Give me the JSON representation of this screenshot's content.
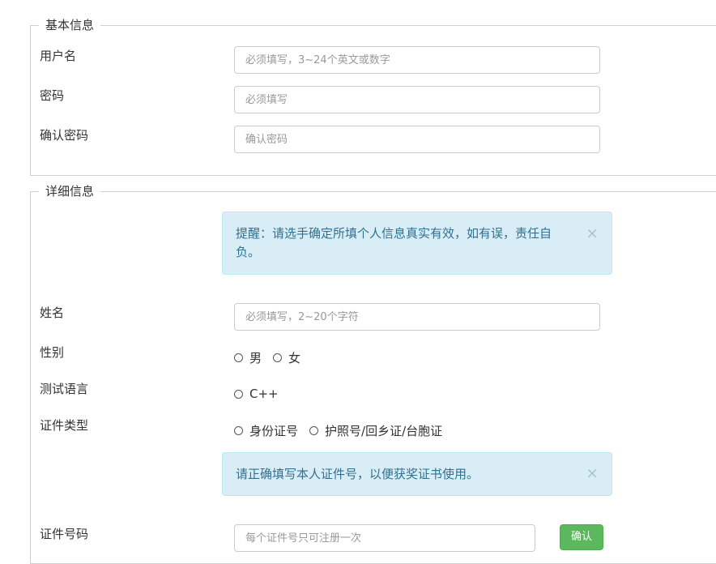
{
  "basic": {
    "legend": "基本信息",
    "username_label": "用户名",
    "username_placeholder": "必须填写，3~24个英文或数字",
    "password_label": "密码",
    "password_placeholder": "必须填写",
    "confirm_label": "确认密码",
    "confirm_placeholder": "确认密码"
  },
  "detail": {
    "legend": "详细信息",
    "alert1": "提醒：请选手确定所填个人信息真实有效，如有误，责任自负。",
    "alert_close": "×",
    "name_label": "姓名",
    "name_placeholder": "必须填写，2~20个字符",
    "gender_label": "性别",
    "gender_options": [
      "男",
      "女"
    ],
    "lang_label": "测试语言",
    "lang_options": [
      "C++"
    ],
    "idtype_label": "证件类型",
    "idtype_options": [
      "身份证号",
      "护照号/回乡证/台胞证"
    ],
    "alert2": "请正确填写本人证件号，以便获奖证书使用。",
    "idnum_label": "证件号码",
    "idnum_placeholder": "每个证件号只可注册一次",
    "confirm_button": "确认"
  },
  "colors": {
    "alert_bg": "#d9edf7",
    "alert_text": "#31708f",
    "button_bg": "#5cb85c"
  }
}
